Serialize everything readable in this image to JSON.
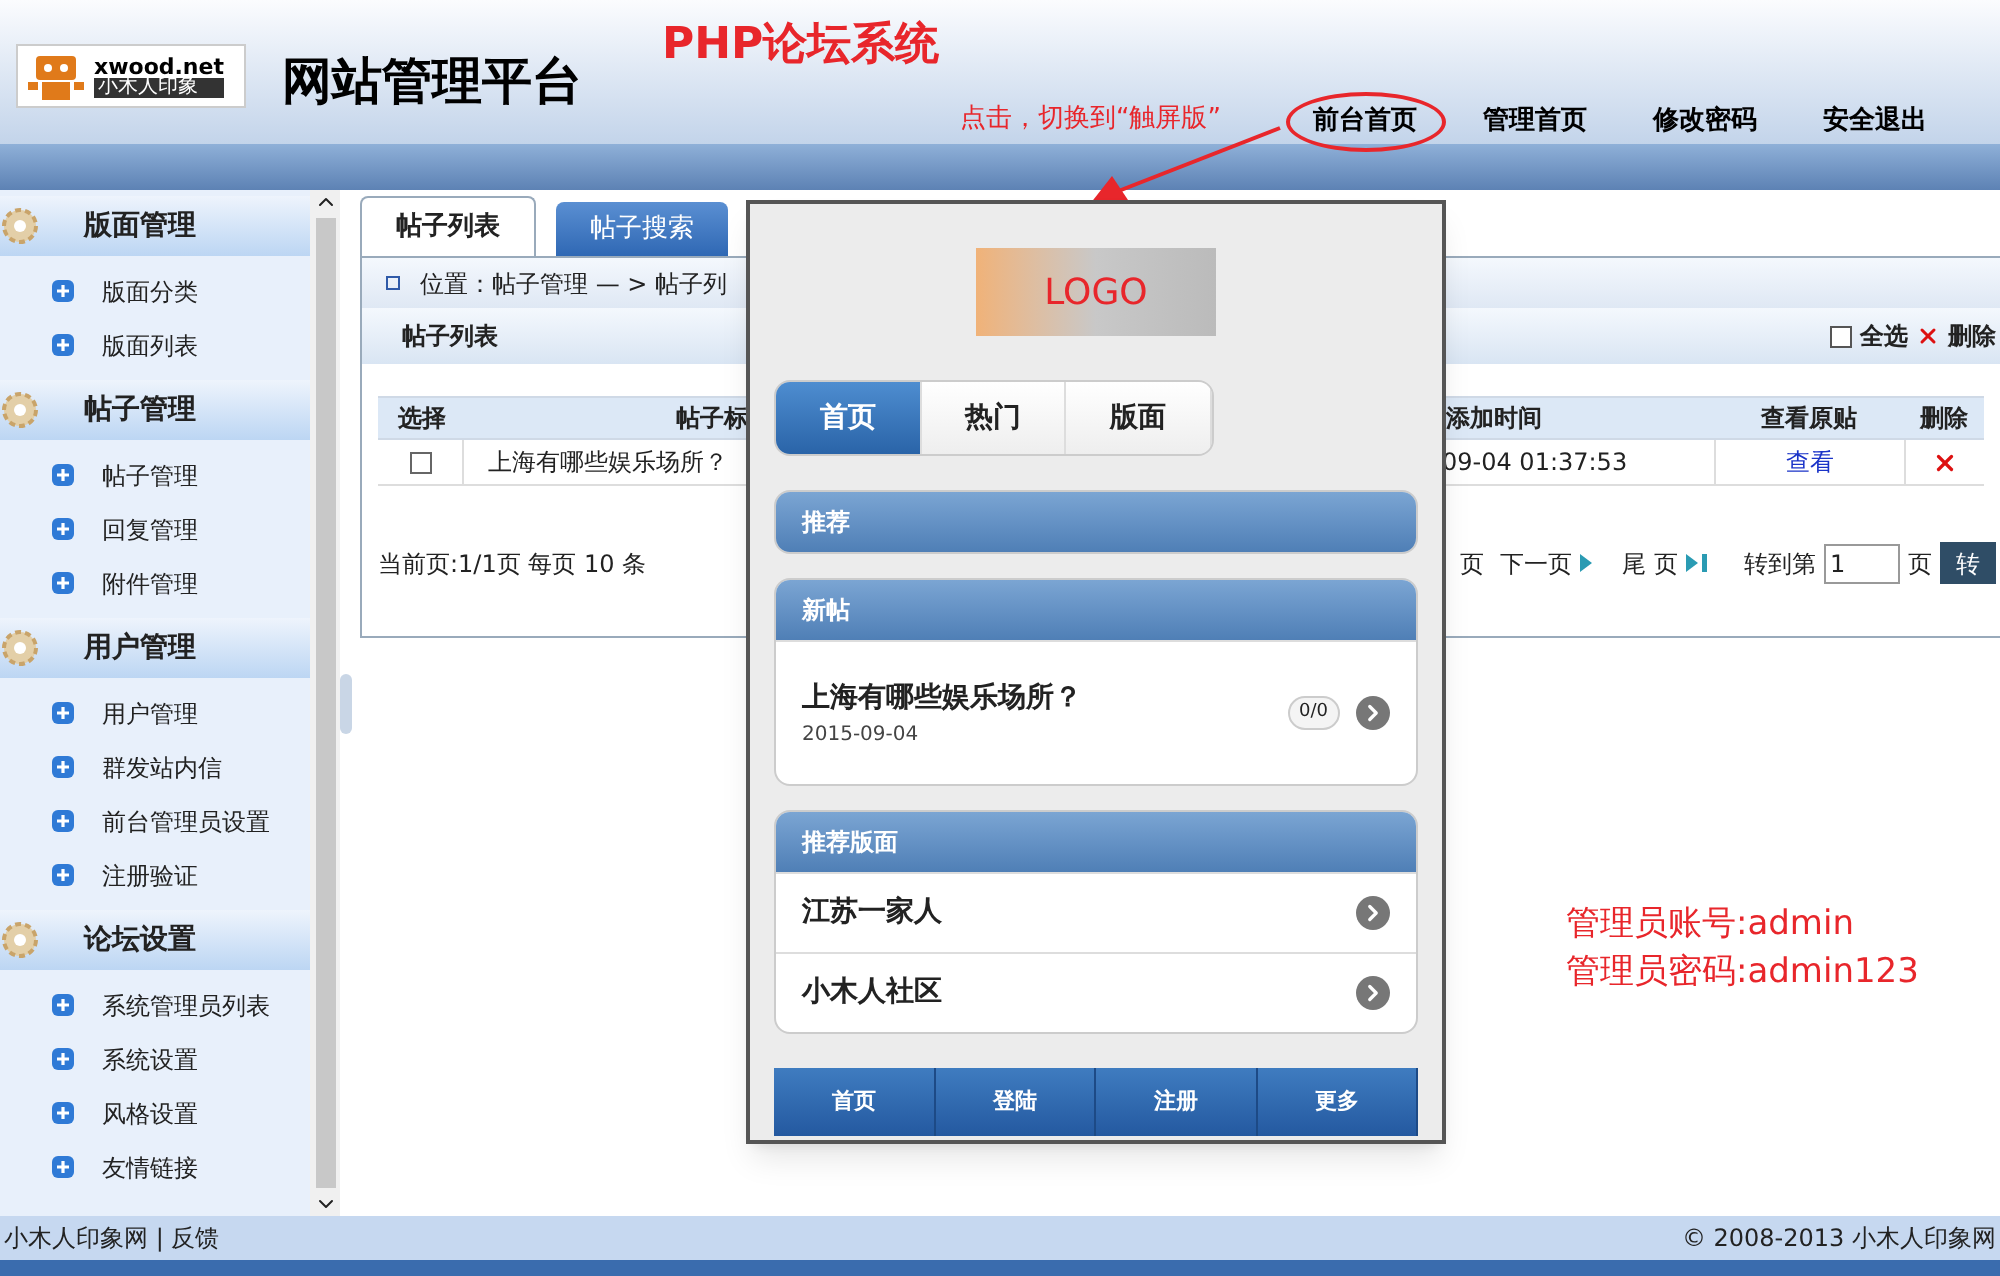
{
  "header": {
    "logo_text": "xwood.net",
    "logo_subtext": "小木人印象",
    "title": "网站管理平台",
    "nav": [
      {
        "label": "前台首页",
        "circled": true
      },
      {
        "label": "管理首页",
        "circled": false
      },
      {
        "label": "修改密码",
        "circled": false
      },
      {
        "label": "安全退出",
        "circled": false
      }
    ]
  },
  "annotations": {
    "title": "PHP论坛系统",
    "hint": "点击，切换到“触屏版”",
    "credentials": [
      "管理员账号:admin",
      "管理员密码:admin123"
    ]
  },
  "sidebar": {
    "sections": [
      {
        "title": "版面管理",
        "items": [
          "版面分类",
          "版面列表"
        ]
      },
      {
        "title": "帖子管理",
        "items": [
          "帖子管理",
          "回复管理",
          "附件管理"
        ]
      },
      {
        "title": "用户管理",
        "items": [
          "用户管理",
          "群发站内信",
          "前台管理员设置",
          "注册验证"
        ]
      },
      {
        "title": "论坛设置",
        "items": [
          "系统管理员列表",
          "系统设置",
          "风格设置",
          "友情链接"
        ]
      }
    ]
  },
  "tabs": [
    {
      "label": "帖子列表",
      "selected": true
    },
    {
      "label": "帖子搜索",
      "selected": false
    }
  ],
  "breadcrumb": "位置：帖子管理 — > 帖子列",
  "panel": {
    "title": "帖子列表",
    "select_all": {
      "label": "全选",
      "checked": false
    },
    "delete_label": "删除"
  },
  "table": {
    "columns": [
      "选择",
      "帖子标",
      "添加时间",
      "查看原贴",
      "删除"
    ],
    "rows": [
      {
        "checked": false,
        "title": "上海有哪些娱乐场所？",
        "added": "09-04 01:37:53",
        "view": "查看"
      }
    ]
  },
  "pagination": {
    "summary": "当前页:1/1页 每页 10 条",
    "prev_partial": "页",
    "next": "下一页",
    "last": "尾 页",
    "goto_label": "转到第",
    "goto_value": "1",
    "goto_unit": "页",
    "goto_button": "转"
  },
  "mobile": {
    "logo": "LOGO",
    "tabs": [
      {
        "label": "首页",
        "selected": true
      },
      {
        "label": "热门",
        "selected": false
      },
      {
        "label": "版面",
        "selected": false
      }
    ],
    "sections": [
      {
        "title": "推荐"
      },
      {
        "title": "新帖",
        "items": [
          {
            "kind": "post",
            "title": "上海有哪些娱乐场所？",
            "date": "2015-09-04",
            "count": "0/0"
          }
        ]
      },
      {
        "title": "推荐版面",
        "items": [
          {
            "kind": "board",
            "title": "江苏一家人"
          },
          {
            "kind": "board",
            "title": "小木人社区"
          }
        ]
      }
    ],
    "navbar": [
      "首页",
      "登陆",
      "注册",
      "更多"
    ]
  },
  "footer": {
    "left": "小木人印象网 | 反馈",
    "right": "© 2008-2013 小木人印象网"
  }
}
